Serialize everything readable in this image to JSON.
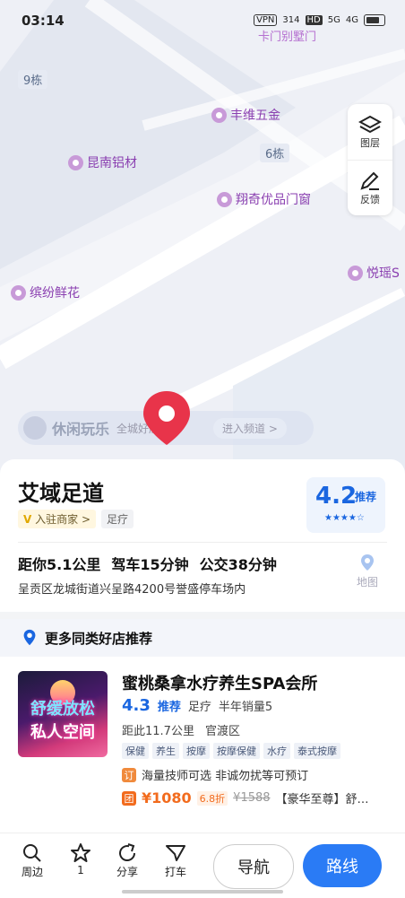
{
  "status": {
    "time": "03:14",
    "vpn": "VPN",
    "speed": "314",
    "hd": "HD",
    "net": "5G",
    "sig": "4G"
  },
  "map": {
    "pois": [
      "丰维五金",
      "昆南铝材",
      "翔奇优品门窗",
      "缤纷鲜花",
      "悦瑶S"
    ],
    "top_label": "卡门别墅门",
    "buildings": [
      "9栋",
      "6栋"
    ],
    "tools": {
      "layers": "图层",
      "feedback": "反馈"
    },
    "banner": {
      "title": "休闲玩乐",
      "sub": "全城好店推荐",
      "enter": "进入频道 >"
    },
    "pin_label": "艾域足道"
  },
  "shop": {
    "name": "艾域足道",
    "vtag": "入驻商家 >",
    "category": "足疗",
    "rating": "4.2",
    "rating_label": "推荐",
    "stars": "★★★★☆",
    "distance": "距你5.1公里",
    "drive": "驾车15分钟",
    "bus": "公交38分钟",
    "address": "呈贡区龙城街道兴呈路4200号誉盛停车场内",
    "map_label": "地图"
  },
  "more": {
    "title": "更多同类好店推荐"
  },
  "rec": {
    "name": "蜜桃桑拿水疗养生SPA会所",
    "thumb_line1": "舒缓放松",
    "thumb_line2": "私人空间",
    "rating": "4.3",
    "rating_label": "推荐",
    "category": "足疗",
    "sales": "半年销量5",
    "distance": "距此11.7公里",
    "district": "官渡区",
    "tags": [
      "保健",
      "养生",
      "按摩",
      "按摩保健",
      "水疗",
      "泰式按摩"
    ],
    "promo1_badge": "订",
    "promo1": "海量技师可选 非诚勿扰等可预订",
    "promo2_badge": "团",
    "price": "¥1080",
    "discount": "6.8折",
    "orig_price": "¥1588",
    "deal": "【豪华至尊】舒…"
  },
  "bottom": {
    "nearby": "周边",
    "fav": "1",
    "share": "分享",
    "taxi": "打车",
    "navigate": "导航",
    "route": "路线"
  },
  "colors": {
    "accent": "#2a7bf5",
    "pin": "#e8344a",
    "rating": "#1a66e0",
    "price": "#f26b1d"
  }
}
